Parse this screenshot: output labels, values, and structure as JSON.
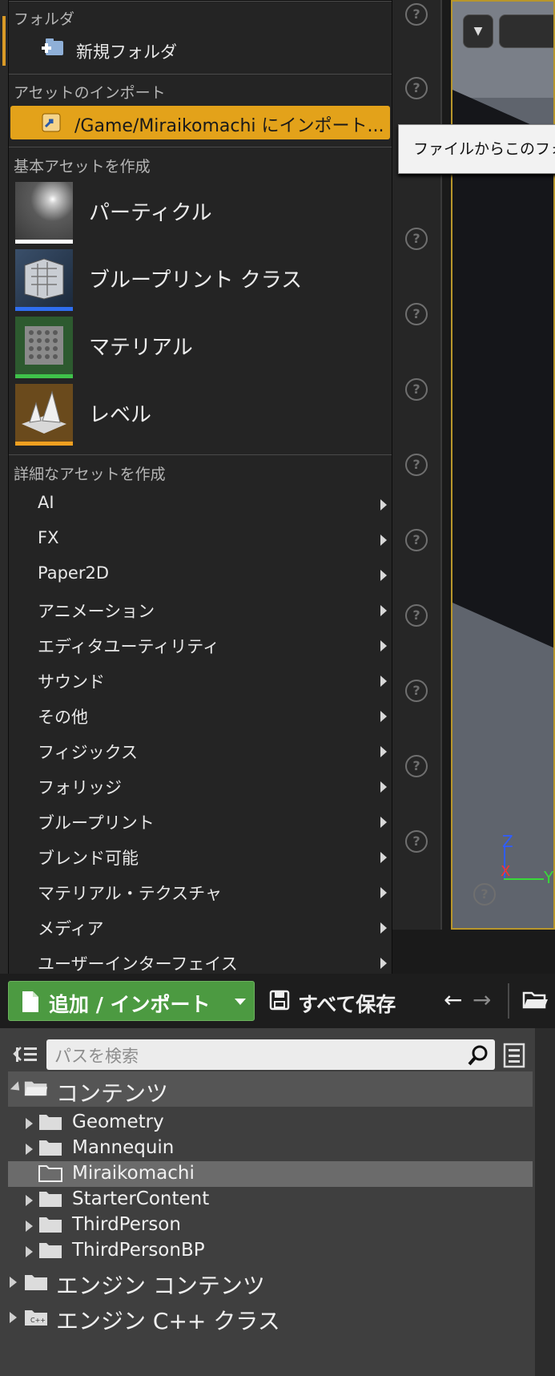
{
  "menu": {
    "section_folder": "フォルダ",
    "new_folder": "新規フォルダ",
    "section_import": "アセットのインポート",
    "import_item": "/Game/Miraikomachi にインポート...",
    "section_basic": "基本アセットを作成",
    "basic_assets": [
      {
        "label": "パーティクル",
        "color": "#ffffff"
      },
      {
        "label": "ブループリント クラス",
        "color": "#2f6ef0"
      },
      {
        "label": "マテリアル",
        "color": "#3fc24a"
      },
      {
        "label": "レベル",
        "color": "#f0a020"
      }
    ],
    "section_advanced": "詳細なアセットを作成",
    "advanced_items": [
      "AI",
      "FX",
      "Paper2D",
      "アニメーション",
      "エディタユーティリティ",
      "サウンド",
      "その他",
      "フィジックス",
      "フォリッジ",
      "ブループリント",
      "ブレンド可能",
      "マテリアル・テクスチャ",
      "メディア",
      "ユーザーインターフェイス"
    ]
  },
  "tooltip": {
    "text": "ファイルからこのフォルダ"
  },
  "viewport": {
    "axis_z": "Z",
    "axis_x": "X",
    "axis_y": "Y"
  },
  "toolbar": {
    "add_import": "追加 / インポート",
    "save_all": "すべて保存"
  },
  "content_browser": {
    "search_placeholder": "パスを検索",
    "root": "コンテンツ",
    "folders": [
      "Geometry",
      "Mannequin",
      "Miraikomachi",
      "StarterContent",
      "ThirdPerson",
      "ThirdPersonBP"
    ],
    "selected_folder": "Miraikomachi",
    "engine_content": "エンジン コンテンツ",
    "engine_cpp": "エンジン C++ クラス"
  },
  "colors": {
    "accent_orange": "#e3a21a",
    "add_green": "#4c9a41",
    "selection": "#6b6b6b"
  }
}
